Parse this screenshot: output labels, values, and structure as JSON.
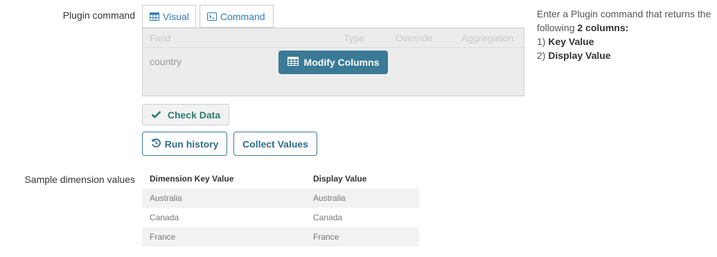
{
  "plugin_command": {
    "label": "Plugin command",
    "tabs": [
      {
        "label": "Visual",
        "icon": "table-icon",
        "active": true
      },
      {
        "label": "Command",
        "icon": "terminal-icon",
        "active": false
      }
    ],
    "visual": {
      "columns": [
        "Field",
        "Type",
        "Override",
        "Aggregation"
      ],
      "rows": [
        {
          "field": "country"
        }
      ],
      "modify_button": "Modify Columns"
    },
    "check_button": "Check Data",
    "run_history_button": "Run history",
    "collect_values_button": "Collect Values"
  },
  "help": {
    "line1": "Enter a Plugin command that returns the",
    "line2_prefix": "following ",
    "line2_bold": "2 columns:",
    "item1_prefix": "1) ",
    "item1_bold": "Key Value",
    "item2_prefix": "2) ",
    "item2_bold": "Display Value"
  },
  "sample": {
    "label": "Sample dimension values",
    "headers": [
      "Dimension Key Value",
      "Display Value"
    ],
    "rows": [
      [
        "Australia",
        "Australia"
      ],
      [
        "Canada",
        "Canada"
      ],
      [
        "France",
        "France"
      ]
    ]
  },
  "colors": {
    "primary": "#3a7a96",
    "check": "#2b7a6f",
    "link": "#337ab7"
  }
}
